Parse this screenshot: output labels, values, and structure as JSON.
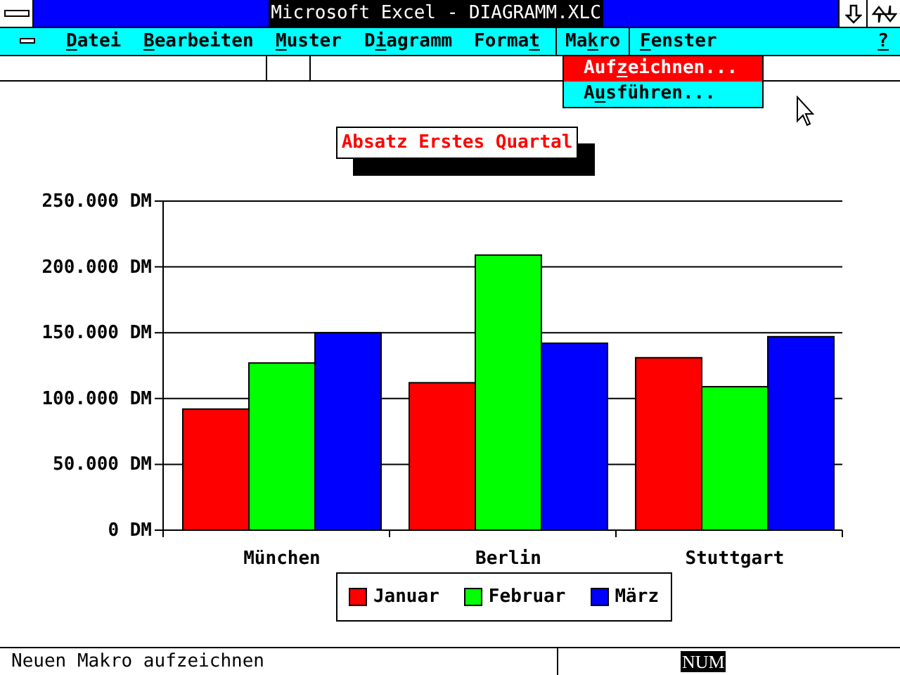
{
  "window": {
    "title": "Microsoft Excel - DIAGRAMM.XLC"
  },
  "menu": [
    {
      "key": "D",
      "post": "atei",
      "selected": false
    },
    {
      "key": "B",
      "post": "earbeiten",
      "selected": false
    },
    {
      "key": "M",
      "post": "uster",
      "selected": false
    },
    {
      "pre": "D",
      "key": "i",
      "post": "agramm",
      "selected": false
    },
    {
      "pre": "Forma",
      "key": "t",
      "selected": false
    },
    {
      "pre": "Ma",
      "key": "k",
      "post": "ro",
      "selected": true
    },
    {
      "key": "F",
      "post": "enster",
      "selected": false
    }
  ],
  "help": "?",
  "dropdown": [
    {
      "pre": "Auf",
      "key": "z",
      "post": "eichnen...",
      "selected": true
    },
    {
      "pre": "A",
      "key": "u",
      "post": "sführen...",
      "selected": false
    }
  ],
  "chart_title": "Absatz Erstes Quartal",
  "chart_data": {
    "type": "bar",
    "grid": true,
    "categories": [
      "München",
      "Berlin",
      "Stuttgart"
    ],
    "ylim": [
      0,
      250000
    ],
    "yticks": [
      {
        "value": 0,
        "label": "0 DM"
      },
      {
        "value": 50000,
        "label": "50.000 DM"
      },
      {
        "value": 100000,
        "label": "100.000 DM"
      },
      {
        "value": 150000,
        "label": "150.000 DM"
      },
      {
        "value": 200000,
        "label": "200.000 DM"
      },
      {
        "value": 250000,
        "label": "250.000 DM"
      }
    ],
    "series": [
      {
        "name": "Januar",
        "color": "#ff0000",
        "values": [
          92000,
          112000,
          131000
        ]
      },
      {
        "name": "Februar",
        "color": "#00ff00",
        "values": [
          127000,
          209000,
          109000
        ]
      },
      {
        "name": "März",
        "color": "#0000ff",
        "values": [
          150000,
          142000,
          147000
        ]
      }
    ]
  },
  "status_bar": {
    "message": "Neuen Makro aufzeichnen",
    "indicator": "NUM"
  }
}
